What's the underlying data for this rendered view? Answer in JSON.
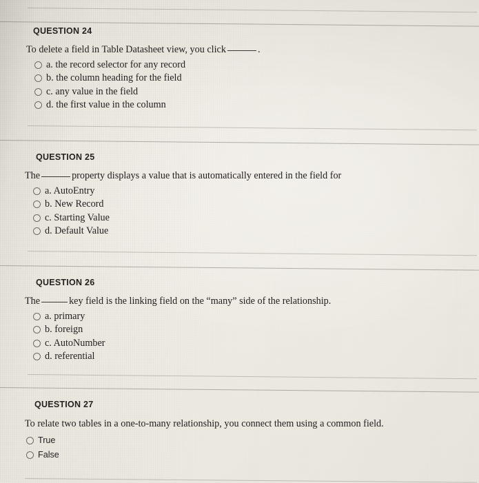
{
  "page": {
    "background_color": "#e9e6df",
    "text_color": "#232120",
    "rule_color": "#605d58"
  },
  "questions": [
    {
      "heading": "QUESTION 24",
      "prompt_before": "To delete a field in Table Datasheet view, you click",
      "prompt_after": ".",
      "has_blank": true,
      "options": [
        {
          "label": "a. the record selector for any record"
        },
        {
          "label": "b. the column heading for the field"
        },
        {
          "label": "c. any value in the field"
        },
        {
          "label": "d. the first value in the column"
        }
      ]
    },
    {
      "heading": "QUESTION 25",
      "prompt_before": "The",
      "prompt_after": "property displays a value that is automatically entered in the field for",
      "has_blank": true,
      "options": [
        {
          "label": "a. AutoEntry"
        },
        {
          "label": "b. New Record"
        },
        {
          "label": "c. Starting Value"
        },
        {
          "label": "d. Default Value"
        }
      ]
    },
    {
      "heading": "QUESTION 26",
      "prompt_before": "The",
      "prompt_after": "key field is the linking field on the “many” side of the relationship.",
      "has_blank": true,
      "options": [
        {
          "label": "a. primary"
        },
        {
          "label": "b. foreign"
        },
        {
          "label": "c. AutoNumber"
        },
        {
          "label": "d. referential"
        }
      ]
    },
    {
      "heading": "QUESTION 27",
      "prompt_before": "To relate two tables in a one-to-many relationship, you connect them using a common field.",
      "prompt_after": "",
      "has_blank": false,
      "options": [
        {
          "label": "True"
        },
        {
          "label": "False"
        }
      ]
    }
  ]
}
